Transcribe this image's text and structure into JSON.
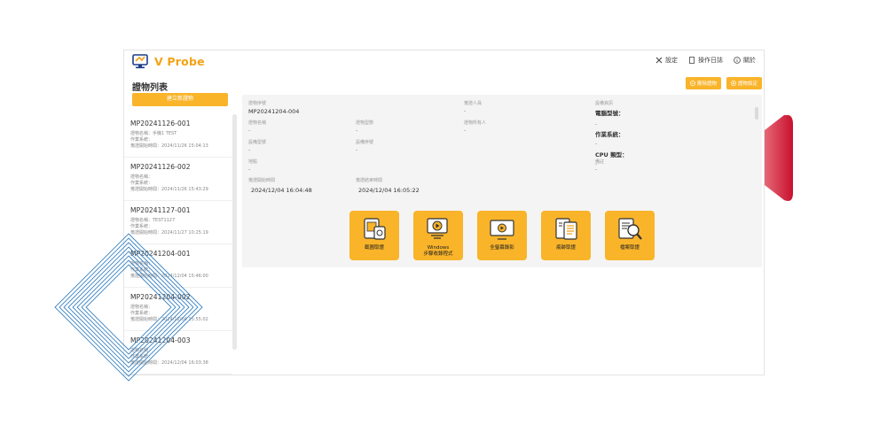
{
  "app": {
    "name": "V Probe"
  },
  "topbar": {
    "settings": "設定",
    "oplog": "操作日誌",
    "about": "關於"
  },
  "sidebar": {
    "title": "證物列表",
    "add_button": "建立新證物",
    "items": [
      {
        "id": "MP20241126-001",
        "name_line": "證物名稱：手機1 TEST",
        "os_line": "作業系統：",
        "time_line": "蒐證開始時間：2024/11/26 15:04:13"
      },
      {
        "id": "MP20241126-002",
        "name_line": "證物名稱：",
        "os_line": "作業系統：",
        "time_line": "蒐證開始時間：2024/11/26 15:43:29"
      },
      {
        "id": "MP20241127-001",
        "name_line": "證物名稱：TEST1127",
        "os_line": "作業系統：",
        "time_line": "蒐證開始時間：2024/11/27 10:25:19"
      },
      {
        "id": "MP20241204-001",
        "name_line": "證物名稱：",
        "os_line": "作業系統：",
        "time_line": "蒐證開始時間：2024/12/04 15:46:00"
      },
      {
        "id": "MP20241204-002",
        "name_line": "證物名稱：",
        "os_line": "作業系統：",
        "time_line": "蒐證開始時間：2024/12/04 15:55:02"
      },
      {
        "id": "MP20241204-003",
        "name_line": "證物名稱：",
        "os_line": "作業系統：",
        "time_line": "蒐證開始時間：2024/12/04 16:03:38"
      }
    ]
  },
  "actions": {
    "delete": "刪除證物",
    "settings": "證物設定"
  },
  "evidence": {
    "serial_label": "證物序號",
    "serial_value": "MP20241204-004",
    "collector_label": "蒐證人員",
    "collector_value": "-",
    "device_info_label": "設備資訊",
    "pc_model_label": "電腦型號：",
    "pc_model_value": "-",
    "os_label": "作業系統：",
    "os_value": "-",
    "cpu_label": "CPU 類型：",
    "cpu_value": "-",
    "name_label": "證物名稱",
    "name_value": "-",
    "type_label": "證物型態",
    "type_value": "-",
    "owner_label": "證物所有人",
    "owner_value": "-",
    "model_label": "設備型號",
    "model_value": "-",
    "device_serial_label": "設備序號",
    "device_serial_value": "-",
    "location_label": "地點",
    "location_value": "-",
    "note_label": "備註",
    "note_value": "-",
    "start_label": "蒐證開始時間",
    "start_value": "2024/12/04 16:04:48",
    "end_label": "蒐證結束時間",
    "end_value": "2024/12/04 16:05:22"
  },
  "tools": [
    {
      "label": "截圖取證",
      "icon": "screenshot-icon"
    },
    {
      "label": "Windows\n步驟收錄程式",
      "icon": "step-recorder-icon"
    },
    {
      "label": "全螢幕錄影",
      "icon": "screen-record-icon"
    },
    {
      "label": "痕跡取證",
      "icon": "trace-icon"
    },
    {
      "label": "檔案取證",
      "icon": "file-search-icon"
    }
  ],
  "colors": {
    "accent": "#f9b42a",
    "brand": "#f4a214",
    "panel": "#f4f4f4"
  }
}
